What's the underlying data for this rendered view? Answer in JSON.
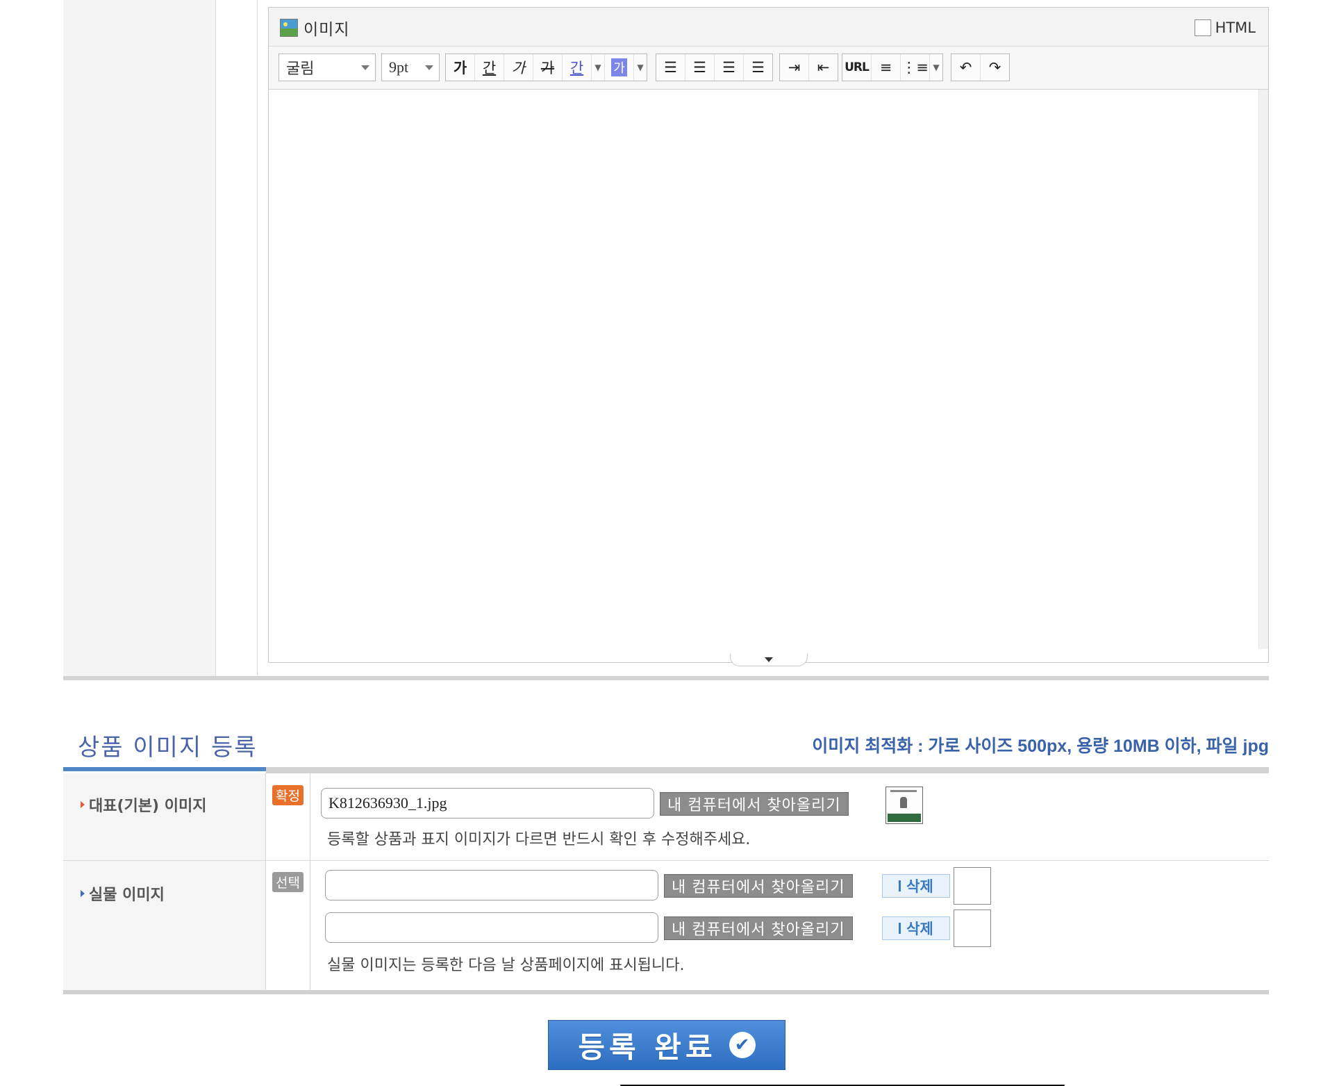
{
  "editor": {
    "tab_label": "이미지",
    "html_label": "HTML",
    "font_value": "굴림",
    "size_value": "9pt",
    "style_buttons": [
      "가",
      "간",
      "가",
      "가",
      "간"
    ],
    "highlight_label": "가",
    "url_label": "URL"
  },
  "images_section": {
    "title": "상품 이미지 등록",
    "optimize_note": "이미지 최적화 : 가로 사이즈 500px, 용량 10MB 이하, 파일 jpg",
    "main_image": {
      "label": "대표(기본) 이미지",
      "badge": "확정",
      "filename": "K812636930_1.jpg",
      "upload_label": "내 컴퓨터에서 찾아올리기",
      "helper": "등록할 상품과 표지 이미지가 다르면 반드시 확인 후 수정해주세요."
    },
    "real_image": {
      "label": "실물 이미지",
      "badge": "선택",
      "upload_label": "내 컴퓨터에서 찾아올리기",
      "delete_label": "삭제",
      "helper": "실물 이미지는 등록한 다음 날 상품페이지에 표시됩니다."
    }
  },
  "submit_label": "등록 완료"
}
